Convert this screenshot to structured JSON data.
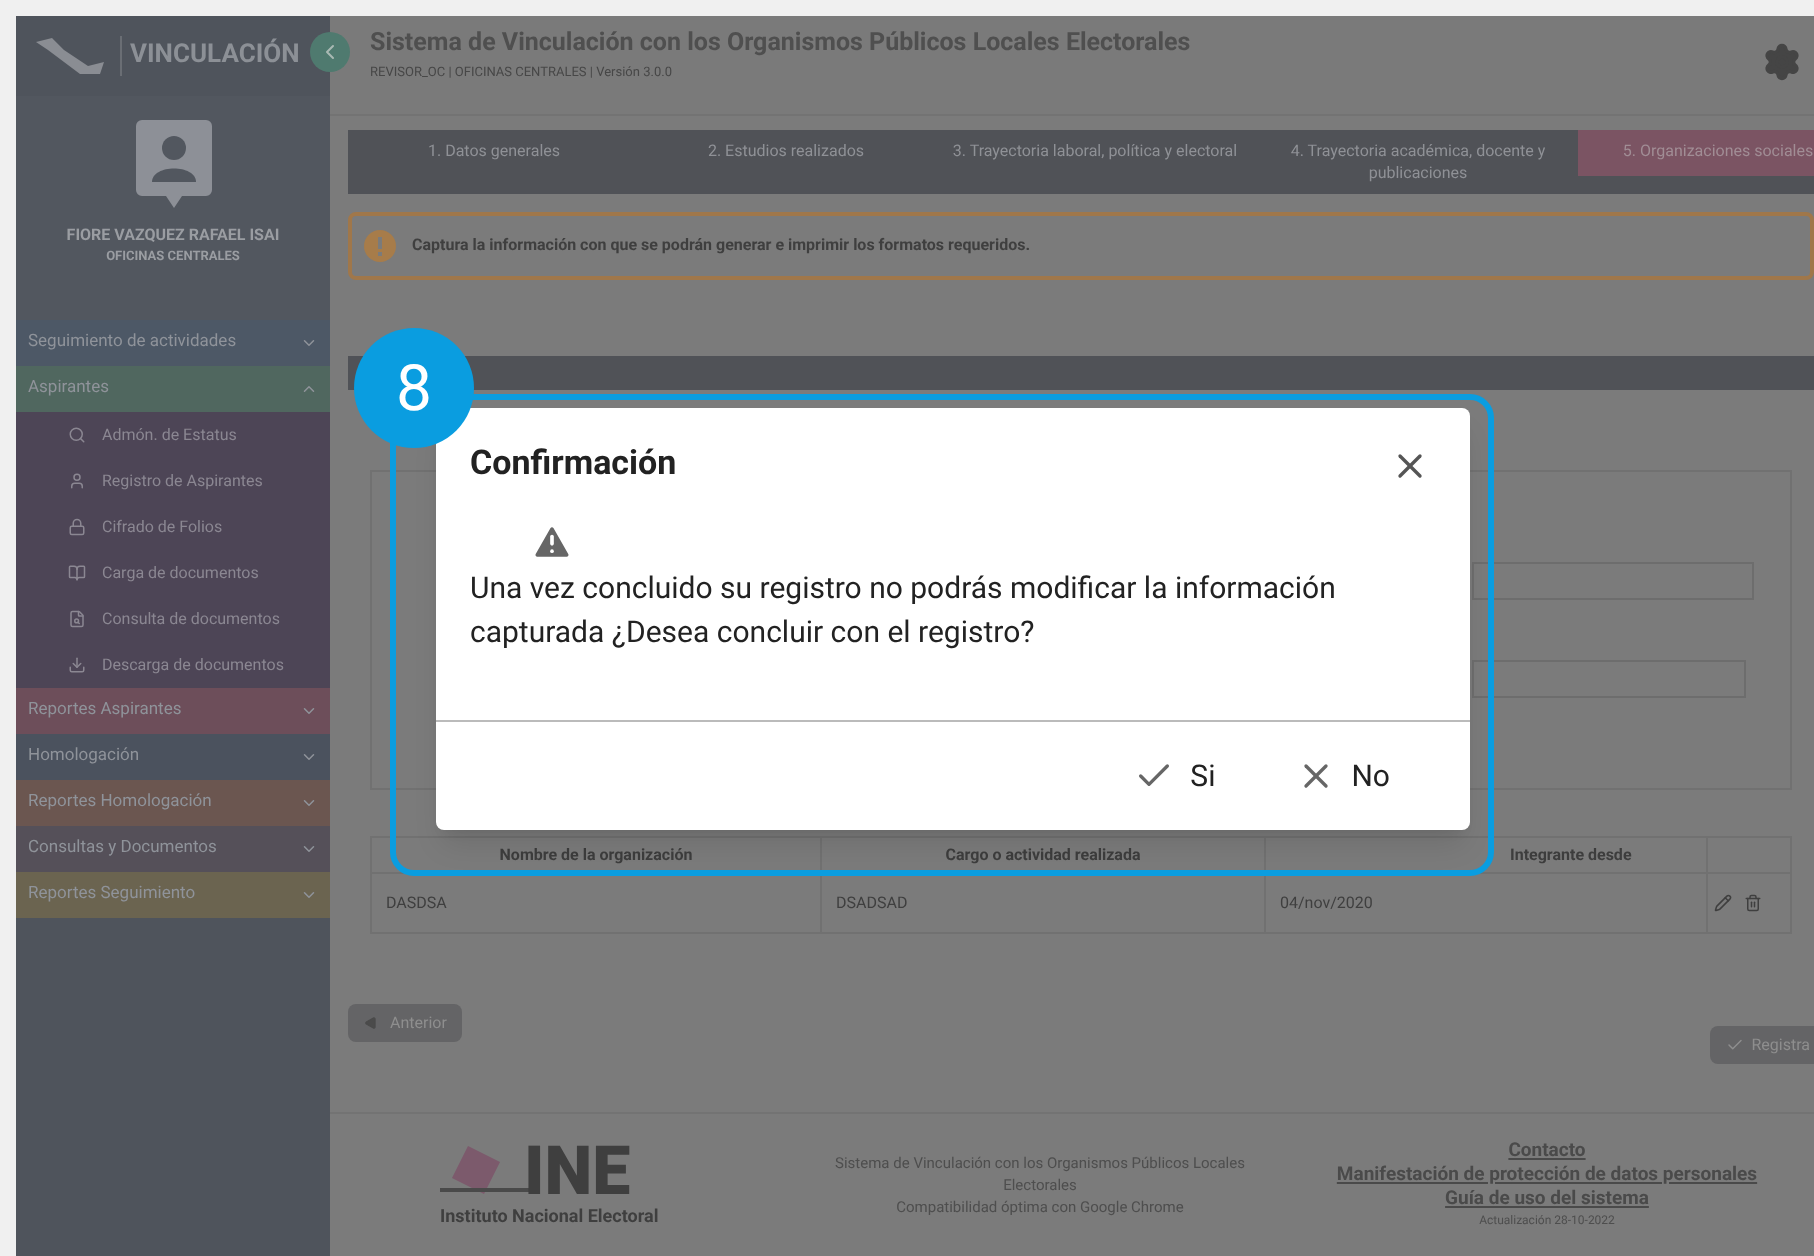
{
  "header": {
    "title": "Sistema de Vinculación con los Organismos Públicos Locales Electorales",
    "subtitle": "REVISOR_OC | OFICINAS CENTRALES | Versión 3.0.0"
  },
  "sidebar": {
    "brand": "VINCULACIÓN",
    "user_name": "FIORE VAZQUEZ RAFAEL ISAI",
    "user_office": "OFICINAS CENTRALES",
    "items": [
      {
        "label": "Seguimiento de actividades",
        "color": "#4d5866",
        "expanded": false
      },
      {
        "label": "Aspirantes",
        "color": "#50675f",
        "expanded": true,
        "children": [
          {
            "label": "Admón. de Estatus"
          },
          {
            "label": "Registro de Aspirantes"
          },
          {
            "label": "Cifrado de Folios"
          },
          {
            "label": "Carga de documentos"
          },
          {
            "label": "Consulta de documentos"
          },
          {
            "label": "Descarga de documentos"
          }
        ]
      },
      {
        "label": "Reportes Aspirantes",
        "color": "#6d4e5a",
        "expanded": false
      },
      {
        "label": "Homologación",
        "color": "#4b525e",
        "expanded": false
      },
      {
        "label": "Reportes Homologación",
        "color": "#6b5650",
        "expanded": false
      },
      {
        "label": "Consultas y Documentos",
        "color": "#555059",
        "expanded": false
      },
      {
        "label": "Reportes Seguimiento",
        "color": "#6b6450",
        "expanded": false
      }
    ]
  },
  "tabs": [
    {
      "label": "1. Datos generales",
      "selected": false
    },
    {
      "label": "2. Estudios realizados",
      "selected": false
    },
    {
      "label": "3. Trayectoria laboral, política y electoral",
      "selected": false
    },
    {
      "label": "4. Trayectoria académica, docente y publicaciones",
      "selected": false
    },
    {
      "label": "5. Organizaciones sociales",
      "selected": true
    }
  ],
  "alert": {
    "text": "Captura la información con que se podrán generar e imprimir los formatos requeridos."
  },
  "table": {
    "columns": [
      "Nombre de la organización",
      "Cargo o actividad realizada",
      "Integrante desde"
    ],
    "rows": [
      {
        "cells": [
          "DASDSA",
          "DSADSAD",
          "04/nov/2020"
        ]
      }
    ]
  },
  "buttons": {
    "back": "Anterior",
    "register": "Registra"
  },
  "footer": {
    "logo_text": "INE",
    "logo_caption": "Instituto Nacional Electoral",
    "info": [
      "Sistema de Vinculación con los Organismos Públicos Locales Electorales",
      "Compatibilidad óptima con Google Chrome"
    ],
    "links": [
      "Contacto",
      "Manifestación de protección de datos personales",
      "Guía de uso del sistema"
    ],
    "updated": "Actualización 28-10-2022"
  },
  "dialog": {
    "title": "Confirmación",
    "message": "Una vez concluido su registro no podrás modificar la información capturada ¿Desea concluir con el registro?",
    "confirm": "Si",
    "cancel": "No"
  },
  "annotation": {
    "label": "8"
  }
}
